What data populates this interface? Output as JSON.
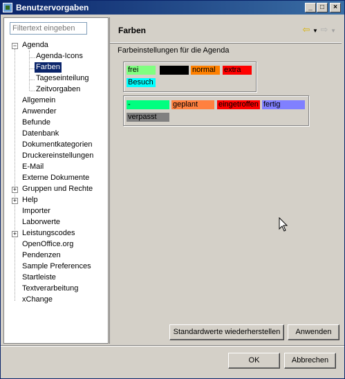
{
  "window": {
    "title": "Benutzervorgaben"
  },
  "filter": {
    "placeholder": "Filtertext eingeben"
  },
  "tree": {
    "agenda": "Agenda",
    "agenda_children": [
      "Agenda-Icons",
      "Farben",
      "Tageseinteilung",
      "Zeitvorgaben"
    ],
    "items": [
      "Allgemein",
      "Anwender",
      "Befunde",
      "Datenbank",
      "Dokumentkategorien",
      "Druckereinstellungen",
      "E-Mail",
      "Externe Dokumente",
      "Gruppen und Rechte",
      "Help",
      "Importer",
      "Laborwerte",
      "Leistungscodes",
      "OpenOffice.org",
      "Pendenzen",
      "Sample Preferences",
      "Startleiste",
      "Textverarbeitung",
      "xChange"
    ],
    "selected": "Farben"
  },
  "page": {
    "title": "Farben",
    "subtitle": "Farbeinstellungen für die Agenda"
  },
  "colors": {
    "group1": [
      {
        "label": "frei",
        "bg": "#80ff80",
        "fg": "#000000"
      },
      {
        "label": "",
        "bg": "#000000",
        "fg": "#000000"
      },
      {
        "label": "normal",
        "bg": "#ff8000",
        "fg": "#000000"
      },
      {
        "label": "extra",
        "bg": "#ff0000",
        "fg": "#000000"
      },
      {
        "label": "Besuch",
        "bg": "#00ffff",
        "fg": "#000000"
      }
    ],
    "group2": [
      {
        "label": "-",
        "bg": "#00ff80",
        "fg": "#000000"
      },
      {
        "label": "geplant",
        "bg": "#ff8040",
        "fg": "#000000"
      },
      {
        "label": "eingetroffen",
        "bg": "#ff0000",
        "fg": "#000000"
      },
      {
        "label": "fertig",
        "bg": "#8080ff",
        "fg": "#000000"
      },
      {
        "label": "verpasst",
        "bg": "#808080",
        "fg": "#000000"
      }
    ]
  },
  "buttons": {
    "defaults": "Standardwerte wiederherstellen",
    "apply": "Anwenden",
    "ok": "OK",
    "cancel": "Abbrechen"
  }
}
